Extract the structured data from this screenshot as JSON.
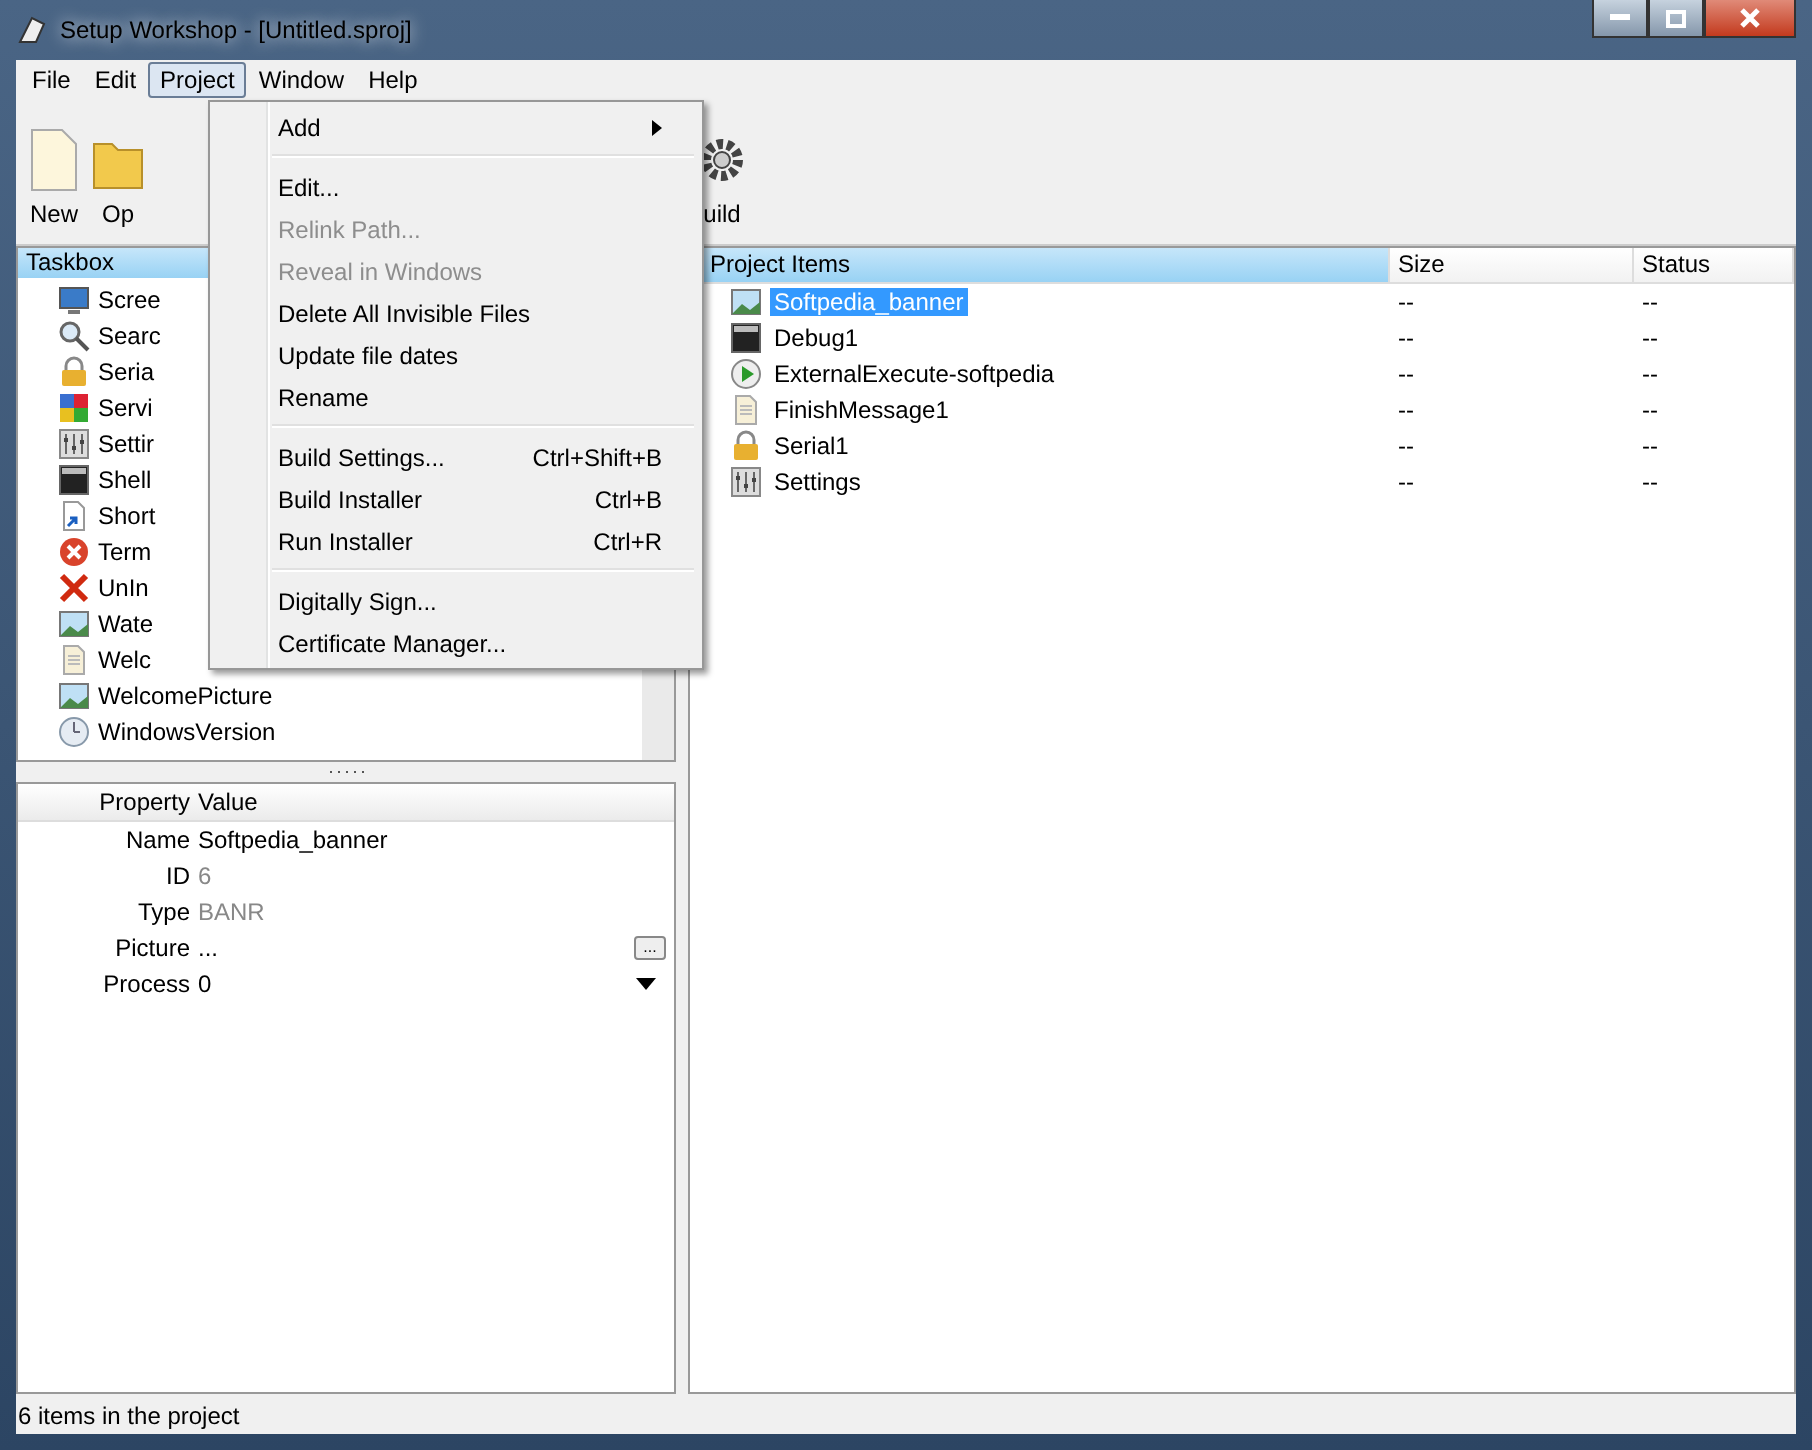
{
  "window": {
    "title": "Setup Workshop - [Untitled.sproj]"
  },
  "menubar": [
    {
      "label": "File",
      "selected": false
    },
    {
      "label": "Edit",
      "selected": false
    },
    {
      "label": "Project",
      "selected": true
    },
    {
      "label": "Window",
      "selected": false
    },
    {
      "label": "Help",
      "selected": false
    }
  ],
  "toolbar": [
    {
      "label": "New",
      "kind": "file"
    },
    {
      "label": "Op",
      "kind": "folder"
    },
    {
      "label": "uild",
      "kind": "gear"
    }
  ],
  "project_menu": [
    [
      {
        "label": "Add",
        "submenu": true,
        "disabled": false
      }
    ],
    [
      {
        "label": "Edit...",
        "disabled": false
      },
      {
        "label": "Relink Path...",
        "disabled": true
      },
      {
        "label": "Reveal in Windows",
        "disabled": true
      },
      {
        "label": "Delete All Invisible Files",
        "disabled": false
      },
      {
        "label": "Update file dates",
        "disabled": false
      },
      {
        "label": "Rename",
        "disabled": false
      }
    ],
    [
      {
        "label": "Build Settings...",
        "shortcut": "Ctrl+Shift+B",
        "disabled": false
      },
      {
        "label": "Build Installer",
        "shortcut": "Ctrl+B",
        "disabled": false
      },
      {
        "label": "Run Installer",
        "shortcut": "Ctrl+R",
        "disabled": false
      }
    ],
    [
      {
        "label": "Digitally Sign...",
        "disabled": false
      },
      {
        "label": "Certificate Manager...",
        "disabled": false
      }
    ]
  ],
  "taskbox": {
    "title": "Taskbox",
    "items": [
      {
        "label": "Scree",
        "kind": "monitor"
      },
      {
        "label": "Searc",
        "kind": "search"
      },
      {
        "label": "Seria",
        "kind": "lock"
      },
      {
        "label": "Servi",
        "kind": "puzzle"
      },
      {
        "label": "Settir",
        "kind": "settings"
      },
      {
        "label": "Shell",
        "kind": "console"
      },
      {
        "label": "Short",
        "kind": "shortcut"
      },
      {
        "label": "Term",
        "kind": "stop"
      },
      {
        "label": "UnIn",
        "kind": "cross"
      },
      {
        "label": "Wate",
        "kind": "image"
      },
      {
        "label": "Welc",
        "kind": "document"
      },
      {
        "label": "WelcomePicture",
        "kind": "image"
      },
      {
        "label": "WindowsVersion",
        "kind": "clock"
      }
    ]
  },
  "properties": {
    "columns": [
      "Property",
      "Value"
    ],
    "rows": [
      {
        "name": "Name",
        "value": "Softpedia_banner",
        "disabled": false
      },
      {
        "name": "ID",
        "value": "6",
        "disabled": true
      },
      {
        "name": "Type",
        "value": "BANR",
        "disabled": true
      },
      {
        "name": "Picture",
        "value": "...",
        "disabled": false,
        "kind": "browse",
        "button": "..."
      },
      {
        "name": "Process",
        "value": "0",
        "disabled": false,
        "kind": "dropdown"
      }
    ]
  },
  "project_items": {
    "columns": [
      "Project Items",
      "Size",
      "Status"
    ],
    "rows": [
      {
        "name": "Softpedia_banner",
        "size": "--",
        "status": "--",
        "kind": "image",
        "selected": true
      },
      {
        "name": "Debug1",
        "size": "--",
        "status": "--",
        "kind": "console",
        "selected": false
      },
      {
        "name": "ExternalExecute-softpedia",
        "size": "--",
        "status": "--",
        "kind": "play",
        "selected": false
      },
      {
        "name": "FinishMessage1",
        "size": "--",
        "status": "--",
        "kind": "document",
        "selected": false
      },
      {
        "name": "Serial1",
        "size": "--",
        "status": "--",
        "kind": "lock",
        "selected": false
      },
      {
        "name": "Settings",
        "size": "--",
        "status": "--",
        "kind": "settings",
        "selected": false
      }
    ]
  },
  "status_bar": "6 items in the project"
}
